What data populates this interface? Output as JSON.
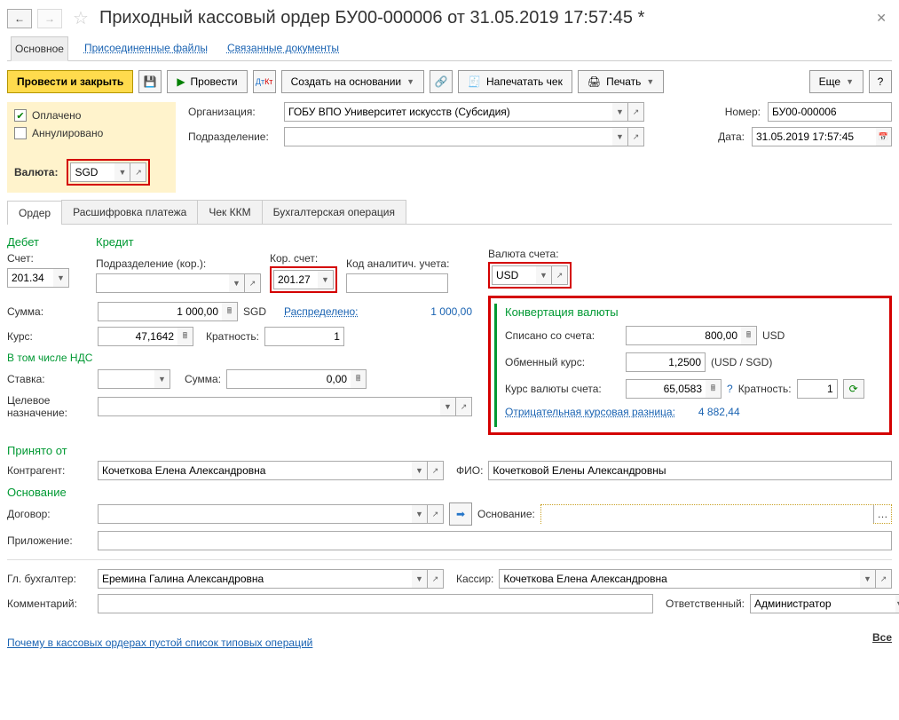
{
  "title": "Приходный кассовый ордер БУ00-000006 от 31.05.2019 17:57:45 *",
  "navTabs": {
    "main": "Основное",
    "files": "Присоединенные файлы",
    "related": "Связанные документы"
  },
  "toolbar": {
    "post_close": "Провести и закрыть",
    "post": "Провести",
    "create_based": "Создать на основании",
    "print_check": "Напечатать чек",
    "print": "Печать",
    "more": "Еще",
    "help": "?"
  },
  "status": {
    "paid": "Оплачено",
    "cancelled": "Аннулировано"
  },
  "header": {
    "org_lbl": "Организация:",
    "org_val": "ГОБУ ВПО Университет искусств (Субсидия)",
    "dept_lbl": "Подразделение:",
    "dept_val": "",
    "num_lbl": "Номер:",
    "num_val": "БУ00-000006",
    "date_lbl": "Дата:",
    "date_val": "31.05.2019 17:57:45",
    "currency_lbl": "Валюта:",
    "currency_val": "SGD"
  },
  "tabs2": {
    "order": "Ордер",
    "decode": "Расшифровка платежа",
    "kkm": "Чек ККМ",
    "acc": "Бухгалтерская операция"
  },
  "order": {
    "debit": "Дебет",
    "credit": "Кредит",
    "acc_lbl": "Счет:",
    "acc_val": "201.34",
    "dept_cor_lbl": "Подразделение (кор.):",
    "dept_cor_val": "",
    "cor_acc_lbl": "Кор. счет:",
    "cor_acc_val": "201.27",
    "anal_lbl": "Код аналитич. учета:",
    "anal_val": "",
    "acc_curr_lbl": "Валюта счета:",
    "acc_curr_val": "USD",
    "sum_lbl": "Сумма:",
    "sum_val": "1 000,00",
    "sum_curr": "SGD",
    "distributed_lbl": "Распределено:",
    "distributed_val": "1 000,00",
    "rate_lbl": "Курс:",
    "rate_val": "47,1642",
    "mult_lbl": "Кратность:",
    "mult_val": "1",
    "vat_head": "В том числе НДС",
    "vat_rate_lbl": "Ставка:",
    "vat_rate_val": "",
    "vat_sum_lbl": "Сумма:",
    "vat_sum_val": "0,00",
    "purpose_lbl": "Целевое назначение:",
    "purpose_val": ""
  },
  "conv": {
    "title": "Конвертация валюты",
    "written_lbl": "Списано со счета:",
    "written_val": "800,00",
    "written_curr": "USD",
    "exch_lbl": "Обменный курс:",
    "exch_val": "1,2500",
    "exch_curr": "(USD / SGD)",
    "acc_rate_lbl": "Курс валюты счета:",
    "acc_rate_val": "65,0583",
    "mult_lbl": "Кратность:",
    "mult_val": "1",
    "neg_lbl": "Отрицательная курсовая разница:",
    "neg_val": "4 882,44"
  },
  "received": {
    "head": "Принято от",
    "contr_lbl": "Контрагент:",
    "contr_val": "Кочеткова Елена Александровна",
    "fio_lbl": "ФИО:",
    "fio_val": "Кочетковой Елены Александровны"
  },
  "basis": {
    "head": "Основание",
    "contract_lbl": "Договор:",
    "contract_val": "",
    "basis_lbl": "Основание:",
    "basis_val": "",
    "attach_lbl": "Приложение:",
    "attach_val": ""
  },
  "footer": {
    "chief_lbl": "Гл. бухгалтер:",
    "chief_val": "Еремина Галина Александровна",
    "cashier_lbl": "Кассир:",
    "cashier_val": "Кочеткова Елена Александровна",
    "comment_lbl": "Комментарий:",
    "comment_val": "",
    "resp_lbl": "Ответственный:",
    "resp_val": "Администратор"
  },
  "bottom_link": "Почему в кассовых ордерах пустой список типовых операций",
  "all_link": "Все"
}
